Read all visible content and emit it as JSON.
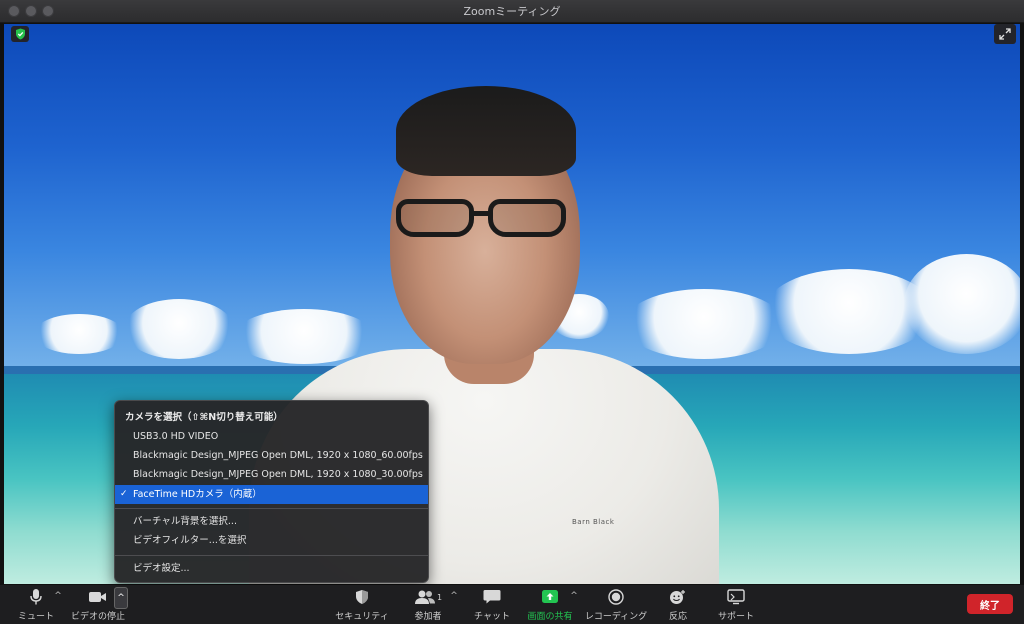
{
  "window": {
    "title": "Zoomミーティング"
  },
  "video": {
    "shirt_print": "Barn Black"
  },
  "camera_menu": {
    "header": "カメラを選択（⇧⌘N切り替え可能）",
    "cameras": [
      {
        "label": "USB3.0 HD VIDEO",
        "selected": false
      },
      {
        "label": "Blackmagic Design_MJPEG Open DML, 1920 x 1080_60.00fps",
        "selected": false
      },
      {
        "label": "Blackmagic Design_MJPEG Open DML, 1920 x 1080_30.00fps",
        "selected": false
      },
      {
        "label": "FaceTime HDカメラ（内蔵）",
        "selected": true
      }
    ],
    "virtual_bg": "バーチャル背景を選択...",
    "video_filter": "ビデオフィルター...を選択",
    "video_settings": "ビデオ設定..."
  },
  "toolbar": {
    "mute": "ミュート",
    "stop_video": "ビデオの停止",
    "security": "セキュリティ",
    "participants": "参加者",
    "participants_count": "1",
    "chat": "チャット",
    "share_screen": "画面の共有",
    "recording": "レコーディング",
    "reactions": "反応",
    "support": "サポート",
    "end": "終了"
  },
  "colors": {
    "end_button": "#d0242a",
    "share_icon": "#23c552",
    "menu_highlight": "#1a63d6",
    "security_badge": "#27c24c"
  }
}
